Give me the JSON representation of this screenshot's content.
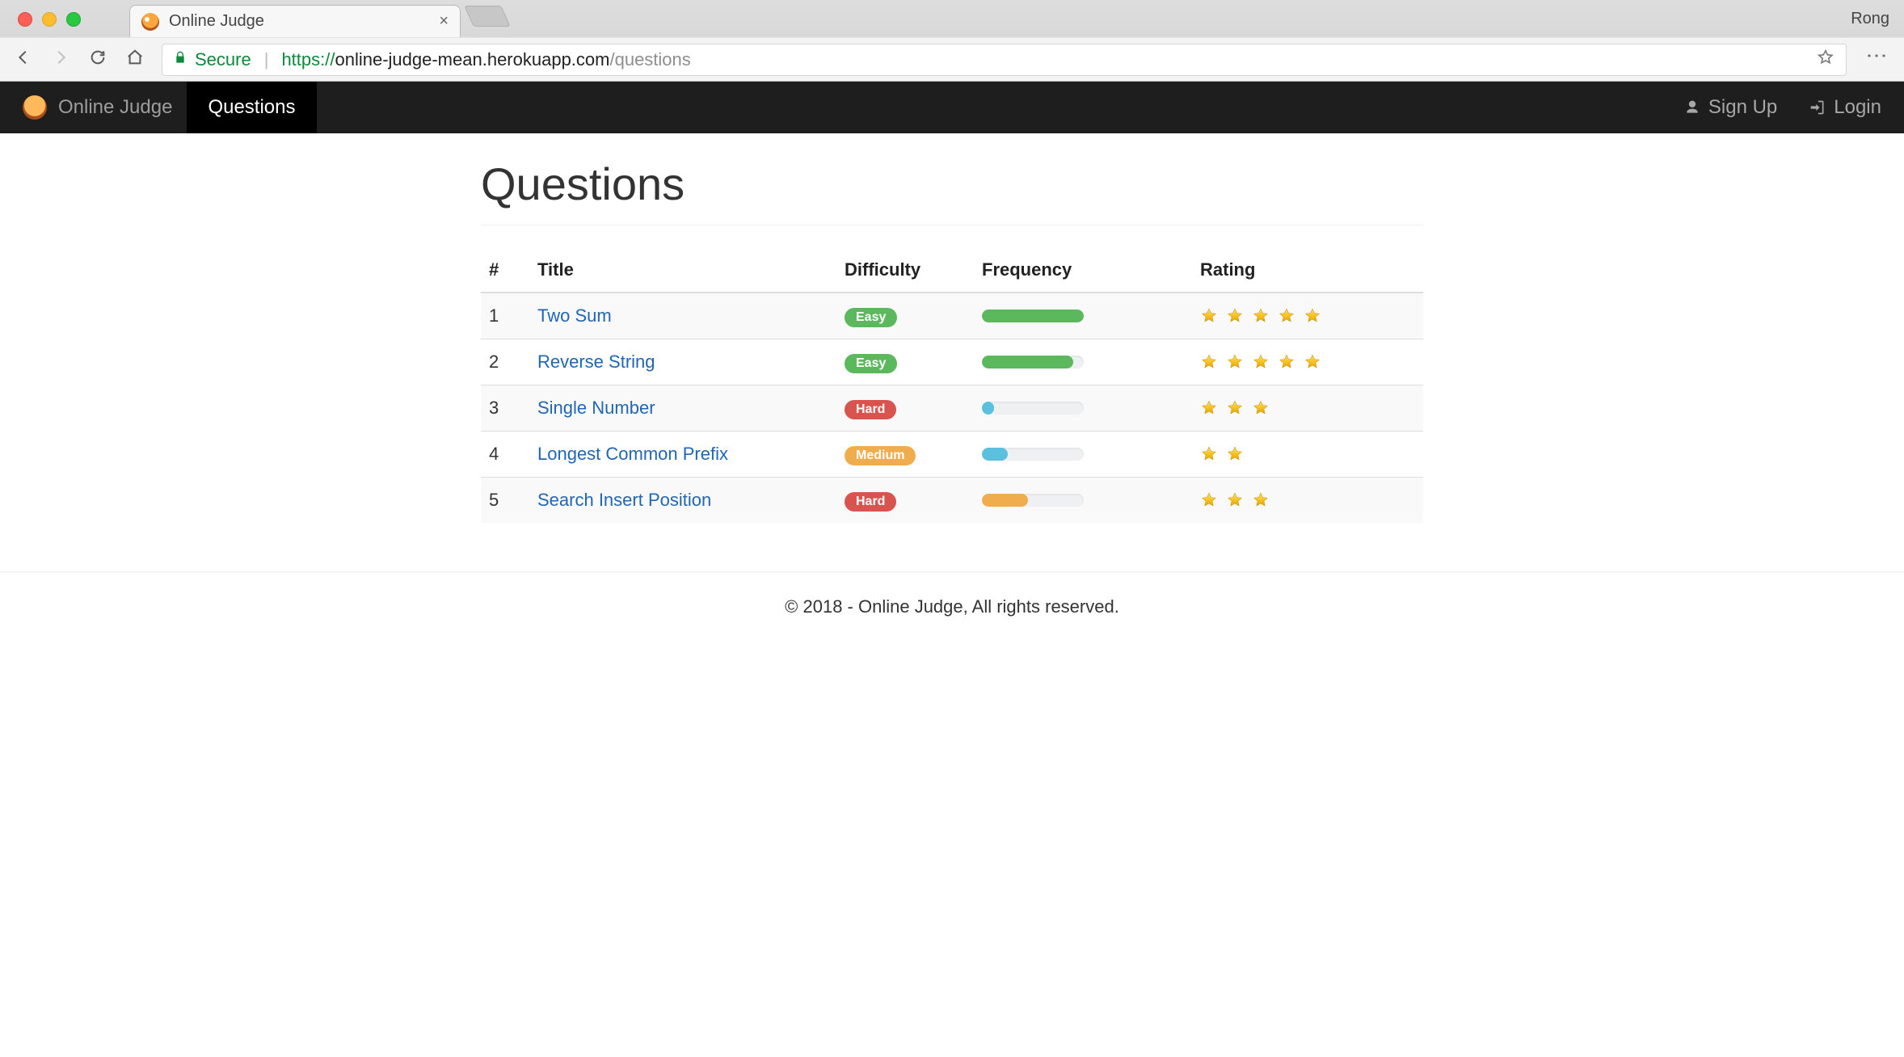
{
  "browser": {
    "profile_name": "Rong",
    "tab": {
      "title": "Online Judge"
    },
    "secure_label": "Secure",
    "url_https": "https://",
    "url_host": "online-judge-mean.herokuapp.com",
    "url_path": "/questions"
  },
  "navbar": {
    "brand": "Online Judge",
    "items": [
      {
        "label": "Questions",
        "active": true
      }
    ],
    "signup_label": "Sign Up",
    "login_label": "Login"
  },
  "page": {
    "title": "Questions"
  },
  "table": {
    "headers": {
      "num": "#",
      "title": "Title",
      "difficulty": "Difficulty",
      "frequency": "Frequency",
      "rating": "Rating"
    },
    "rows": [
      {
        "num": "1",
        "title": "Two Sum",
        "difficulty": "Easy",
        "freq_pct": 100,
        "freq_color": "green",
        "rating": 5
      },
      {
        "num": "2",
        "title": "Reverse String",
        "difficulty": "Easy",
        "freq_pct": 90,
        "freq_color": "green",
        "rating": 5
      },
      {
        "num": "3",
        "title": "Single Number",
        "difficulty": "Hard",
        "freq_pct": 12,
        "freq_color": "blue",
        "rating": 3
      },
      {
        "num": "4",
        "title": "Longest Common Prefix",
        "difficulty": "Medium",
        "freq_pct": 25,
        "freq_color": "blue",
        "rating": 2
      },
      {
        "num": "5",
        "title": "Search Insert Position",
        "difficulty": "Hard",
        "freq_pct": 45,
        "freq_color": "orange",
        "rating": 3
      }
    ]
  },
  "footer": {
    "text": "© 2018 - Online Judge, All rights reserved."
  }
}
